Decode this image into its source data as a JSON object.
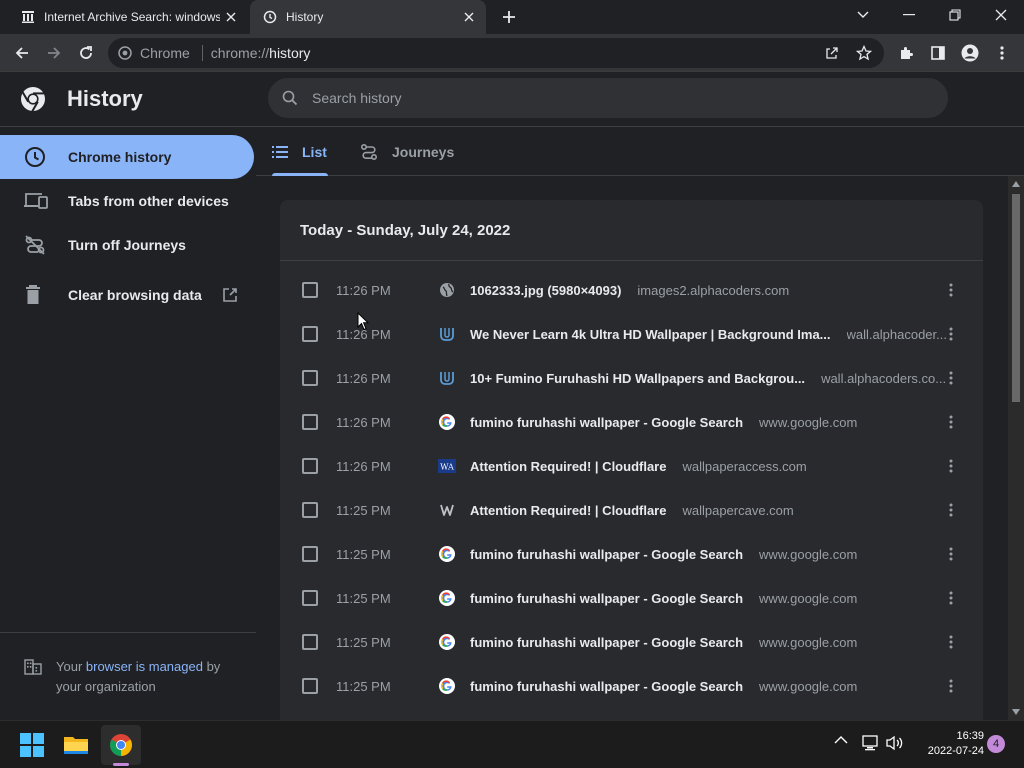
{
  "browser": {
    "tabs": [
      {
        "title": "Internet Archive Search: windows",
        "favicon": "archive-icon",
        "active": false
      },
      {
        "title": "History",
        "favicon": "history-clock-icon",
        "active": true
      }
    ],
    "omnibox": {
      "chip": "Chrome",
      "scheme": "chrome://",
      "host": "history"
    }
  },
  "page": {
    "title": "History",
    "search_placeholder": "Search history"
  },
  "sidebar": {
    "items": [
      {
        "label": "Chrome history",
        "icon": "clock-icon",
        "selected": true
      },
      {
        "label": "Tabs from other devices",
        "icon": "devices-icon",
        "selected": false
      },
      {
        "label": "Turn off Journeys",
        "icon": "journeys-off-icon",
        "selected": false
      },
      {
        "label": "Clear browsing data",
        "icon": "trash-icon",
        "selected": false
      }
    ],
    "managed": {
      "prefix": "Your ",
      "link": "browser is managed",
      "suffix": " by",
      "line2": "your organization"
    }
  },
  "view_tabs": [
    {
      "label": "List",
      "active": true
    },
    {
      "label": "Journeys",
      "active": false
    }
  ],
  "history": {
    "date_heading": "Today - Sunday, July 24, 2022",
    "entries": [
      {
        "time": "11:26 PM",
        "title": "1062333.jpg (5980×4093)",
        "domain": "images2.alphacoders.com",
        "favicon": "globe"
      },
      {
        "time": "11:26 PM",
        "title": "We Never Learn 4k Ultra HD Wallpaper | Background Ima...",
        "domain": "wall.alphacoder...",
        "favicon": "alphacoders"
      },
      {
        "time": "11:26 PM",
        "title": "10+ Fumino Furuhashi HD Wallpapers and Backgrou...",
        "domain": "wall.alphacoders.co...",
        "favicon": "alphacoders"
      },
      {
        "time": "11:26 PM",
        "title": "fumino furuhashi wallpaper - Google Search",
        "domain": "www.google.com",
        "favicon": "google"
      },
      {
        "time": "11:26 PM",
        "title": "Attention Required! | Cloudflare",
        "domain": "wallpaperaccess.com",
        "favicon": "wa"
      },
      {
        "time": "11:25 PM",
        "title": "Attention Required! | Cloudflare",
        "domain": "wallpapercave.com",
        "favicon": "w"
      },
      {
        "time": "11:25 PM",
        "title": "fumino furuhashi wallpaper - Google Search",
        "domain": "www.google.com",
        "favicon": "google"
      },
      {
        "time": "11:25 PM",
        "title": "fumino furuhashi wallpaper - Google Search",
        "domain": "www.google.com",
        "favicon": "google"
      },
      {
        "time": "11:25 PM",
        "title": "fumino furuhashi wallpaper - Google Search",
        "domain": "www.google.com",
        "favicon": "google"
      },
      {
        "time": "11:25 PM",
        "title": "fumino furuhashi wallpaper - Google Search",
        "domain": "www.google.com",
        "favicon": "google"
      }
    ]
  },
  "taskbar": {
    "time": "16:39",
    "date": "2022-07-24",
    "notifications": "4"
  },
  "colors": {
    "accent": "#8ab4f8",
    "background": "#202124",
    "card": "#292a2d"
  }
}
